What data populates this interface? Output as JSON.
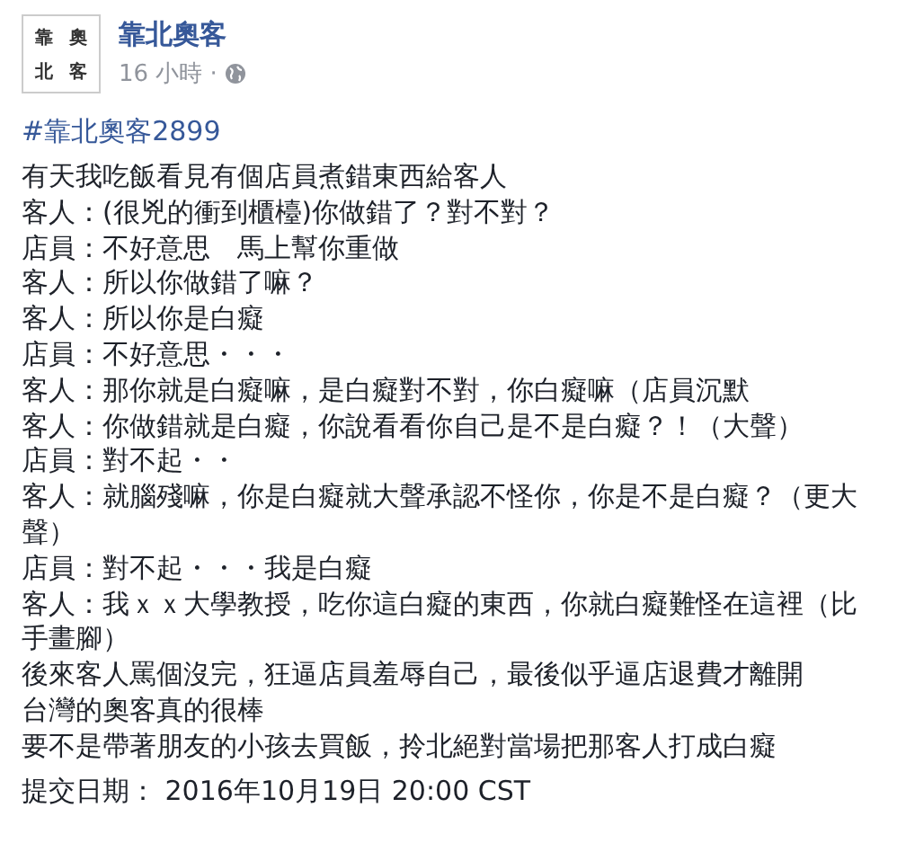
{
  "post": {
    "avatar_chars": [
      "靠",
      "奧",
      "北",
      "客"
    ],
    "author": "靠北奧客",
    "time": "16 小時",
    "separator": "·",
    "hashtag": "#靠北奧客2899",
    "lines": [
      "有天我吃飯看見有個店員煮錯東西給客人",
      "客人：(很兇的衝到櫃檯)你做錯了？對不對？",
      "店員：不好意思　馬上幫你重做",
      "客人：所以你做錯了嘛？",
      "客人：所以你是白癡",
      "店員：不好意思・・・",
      "客人：那你就是白癡嘛，是白癡對不對，你白癡嘛（店員沉默",
      "客人：你做錯就是白癡，你說看看你自己是不是白癡？！（大聲）",
      "店員：對不起・・",
      "客人：就腦殘嘛，你是白癡就大聲承認不怪你，你是不是白癡？（更大聲）",
      "店員：對不起・・・我是白癡",
      "客人：我ｘｘ大學教授，吃你這白癡的東西，你就白癡難怪在這裡（比手畫腳）",
      "後來客人罵個沒完，狂逼店員羞辱自己，最後似乎逼店退費才離開",
      "台灣的奧客真的很棒",
      "要不是帶著朋友的小孩去買飯，拎北絕對當場把那客人打成白癡"
    ],
    "submitted": "提交日期： 2016年10月19日 20:00 CST"
  }
}
